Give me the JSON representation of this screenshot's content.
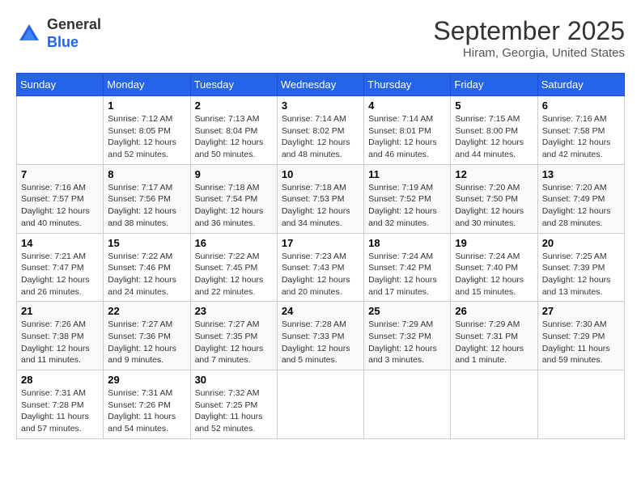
{
  "header": {
    "logo_line1": "General",
    "logo_line2": "Blue",
    "month": "September 2025",
    "location": "Hiram, Georgia, United States"
  },
  "days_of_week": [
    "Sunday",
    "Monday",
    "Tuesday",
    "Wednesday",
    "Thursday",
    "Friday",
    "Saturday"
  ],
  "weeks": [
    [
      {
        "day": "",
        "info": ""
      },
      {
        "day": "1",
        "info": "Sunrise: 7:12 AM\nSunset: 8:05 PM\nDaylight: 12 hours\nand 52 minutes."
      },
      {
        "day": "2",
        "info": "Sunrise: 7:13 AM\nSunset: 8:04 PM\nDaylight: 12 hours\nand 50 minutes."
      },
      {
        "day": "3",
        "info": "Sunrise: 7:14 AM\nSunset: 8:02 PM\nDaylight: 12 hours\nand 48 minutes."
      },
      {
        "day": "4",
        "info": "Sunrise: 7:14 AM\nSunset: 8:01 PM\nDaylight: 12 hours\nand 46 minutes."
      },
      {
        "day": "5",
        "info": "Sunrise: 7:15 AM\nSunset: 8:00 PM\nDaylight: 12 hours\nand 44 minutes."
      },
      {
        "day": "6",
        "info": "Sunrise: 7:16 AM\nSunset: 7:58 PM\nDaylight: 12 hours\nand 42 minutes."
      }
    ],
    [
      {
        "day": "7",
        "info": "Sunrise: 7:16 AM\nSunset: 7:57 PM\nDaylight: 12 hours\nand 40 minutes."
      },
      {
        "day": "8",
        "info": "Sunrise: 7:17 AM\nSunset: 7:56 PM\nDaylight: 12 hours\nand 38 minutes."
      },
      {
        "day": "9",
        "info": "Sunrise: 7:18 AM\nSunset: 7:54 PM\nDaylight: 12 hours\nand 36 minutes."
      },
      {
        "day": "10",
        "info": "Sunrise: 7:18 AM\nSunset: 7:53 PM\nDaylight: 12 hours\nand 34 minutes."
      },
      {
        "day": "11",
        "info": "Sunrise: 7:19 AM\nSunset: 7:52 PM\nDaylight: 12 hours\nand 32 minutes."
      },
      {
        "day": "12",
        "info": "Sunrise: 7:20 AM\nSunset: 7:50 PM\nDaylight: 12 hours\nand 30 minutes."
      },
      {
        "day": "13",
        "info": "Sunrise: 7:20 AM\nSunset: 7:49 PM\nDaylight: 12 hours\nand 28 minutes."
      }
    ],
    [
      {
        "day": "14",
        "info": "Sunrise: 7:21 AM\nSunset: 7:47 PM\nDaylight: 12 hours\nand 26 minutes."
      },
      {
        "day": "15",
        "info": "Sunrise: 7:22 AM\nSunset: 7:46 PM\nDaylight: 12 hours\nand 24 minutes."
      },
      {
        "day": "16",
        "info": "Sunrise: 7:22 AM\nSunset: 7:45 PM\nDaylight: 12 hours\nand 22 minutes."
      },
      {
        "day": "17",
        "info": "Sunrise: 7:23 AM\nSunset: 7:43 PM\nDaylight: 12 hours\nand 20 minutes."
      },
      {
        "day": "18",
        "info": "Sunrise: 7:24 AM\nSunset: 7:42 PM\nDaylight: 12 hours\nand 17 minutes."
      },
      {
        "day": "19",
        "info": "Sunrise: 7:24 AM\nSunset: 7:40 PM\nDaylight: 12 hours\nand 15 minutes."
      },
      {
        "day": "20",
        "info": "Sunrise: 7:25 AM\nSunset: 7:39 PM\nDaylight: 12 hours\nand 13 minutes."
      }
    ],
    [
      {
        "day": "21",
        "info": "Sunrise: 7:26 AM\nSunset: 7:38 PM\nDaylight: 12 hours\nand 11 minutes."
      },
      {
        "day": "22",
        "info": "Sunrise: 7:27 AM\nSunset: 7:36 PM\nDaylight: 12 hours\nand 9 minutes."
      },
      {
        "day": "23",
        "info": "Sunrise: 7:27 AM\nSunset: 7:35 PM\nDaylight: 12 hours\nand 7 minutes."
      },
      {
        "day": "24",
        "info": "Sunrise: 7:28 AM\nSunset: 7:33 PM\nDaylight: 12 hours\nand 5 minutes."
      },
      {
        "day": "25",
        "info": "Sunrise: 7:29 AM\nSunset: 7:32 PM\nDaylight: 12 hours\nand 3 minutes."
      },
      {
        "day": "26",
        "info": "Sunrise: 7:29 AM\nSunset: 7:31 PM\nDaylight: 12 hours\nand 1 minute."
      },
      {
        "day": "27",
        "info": "Sunrise: 7:30 AM\nSunset: 7:29 PM\nDaylight: 11 hours\nand 59 minutes."
      }
    ],
    [
      {
        "day": "28",
        "info": "Sunrise: 7:31 AM\nSunset: 7:28 PM\nDaylight: 11 hours\nand 57 minutes."
      },
      {
        "day": "29",
        "info": "Sunrise: 7:31 AM\nSunset: 7:26 PM\nDaylight: 11 hours\nand 54 minutes."
      },
      {
        "day": "30",
        "info": "Sunrise: 7:32 AM\nSunset: 7:25 PM\nDaylight: 11 hours\nand 52 minutes."
      },
      {
        "day": "",
        "info": ""
      },
      {
        "day": "",
        "info": ""
      },
      {
        "day": "",
        "info": ""
      },
      {
        "day": "",
        "info": ""
      }
    ]
  ]
}
